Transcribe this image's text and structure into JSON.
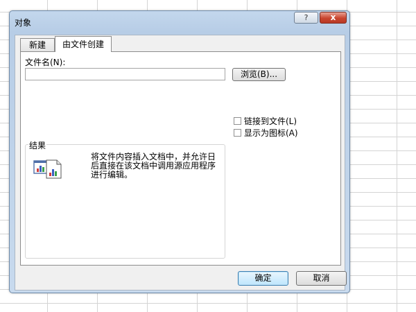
{
  "dialog": {
    "title": "对象",
    "help_label": "?",
    "close_label": "x"
  },
  "tabs": [
    {
      "label": "新建",
      "active": false
    },
    {
      "label": "由文件创建",
      "active": true
    }
  ],
  "file": {
    "label": "文件名(N):",
    "value": "",
    "browse_label": "浏览(B)..."
  },
  "options": {
    "link_label": "链接到文件(L)",
    "link_checked": false,
    "icon_label": "显示为图标(A)",
    "icon_checked": false
  },
  "result": {
    "label": "结果",
    "text": "将文件内容插入文档中，并允许日后直接在该文档中调用源应用程序进行编辑。",
    "icon": "embedded-chart-document-icon"
  },
  "buttons": {
    "ok_label": "确定",
    "cancel_label": "取消"
  }
}
